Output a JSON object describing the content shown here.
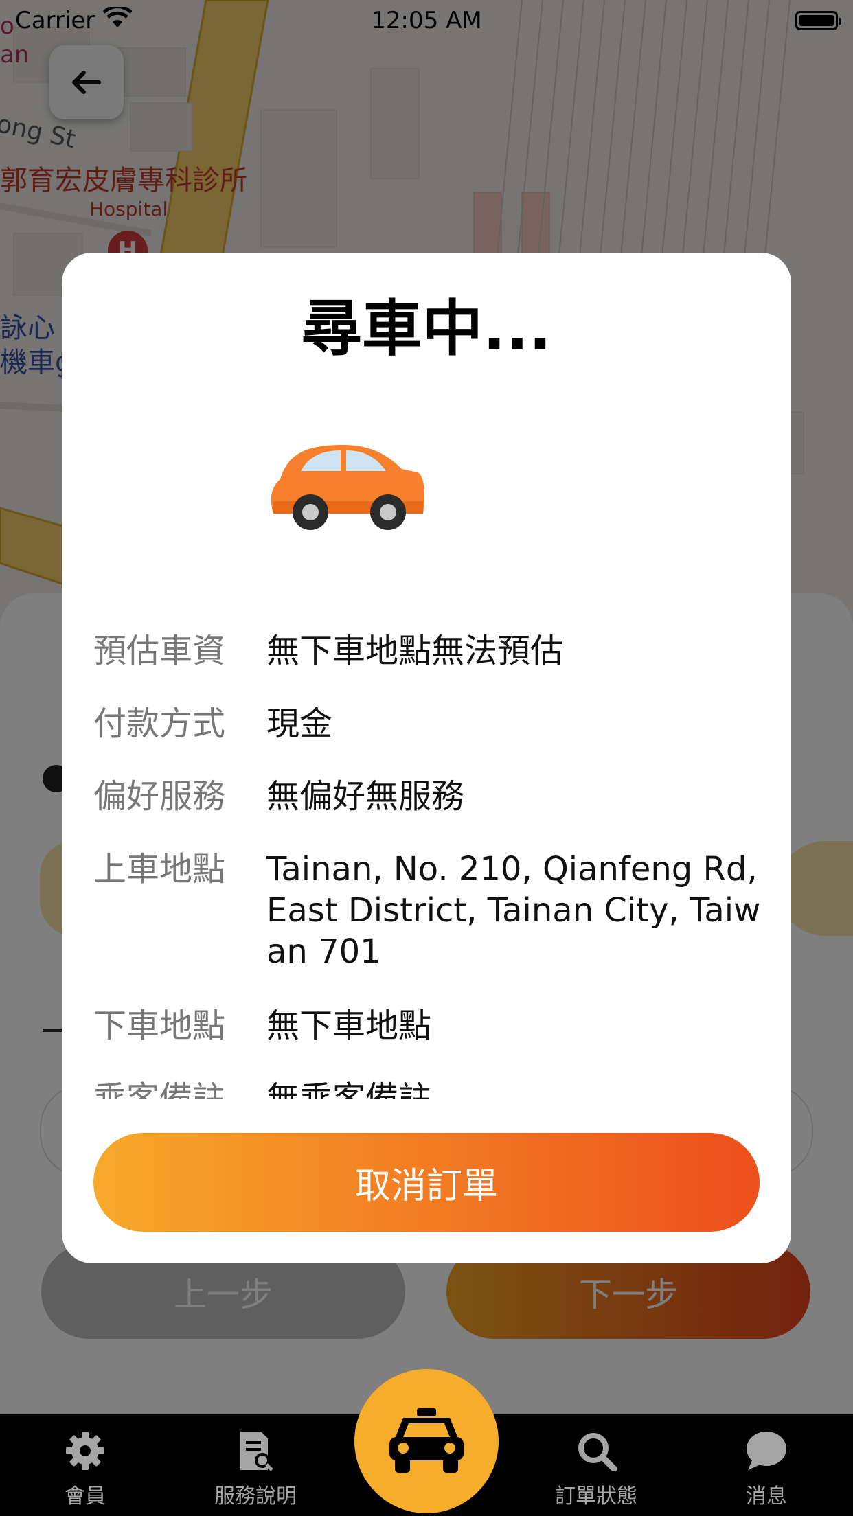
{
  "status_bar": {
    "carrier": "Carrier",
    "time": "12:05 AM"
  },
  "map": {
    "clinic_name": "郭育宏皮膚專科診所",
    "hospital_label": "Hospital",
    "hospital_pin": "H",
    "street_label": "ong St",
    "top_label_1": "o",
    "top_label_2": "an",
    "poi_label_1": "詠心",
    "poi_label_2": "機車g"
  },
  "modal": {
    "title": "尋車中...",
    "rows": [
      {
        "label": "預估車資",
        "value": "無下車地點無法預估"
      },
      {
        "label": "付款方式",
        "value": "現金"
      },
      {
        "label": "偏好服務",
        "value": "無偏好無服務"
      },
      {
        "label": "上車地點",
        "value": "Tainan, No. 210, Qianfeng Rd, East District, Tainan City, Taiwan 701"
      },
      {
        "label": "下車地點",
        "value": "無下車地點"
      },
      {
        "label": "乘客備註",
        "value": "無乘客備註"
      }
    ],
    "cancel_label": "取消訂單"
  },
  "sheet": {
    "prev_label": "上一步",
    "next_label": "下一步"
  },
  "tabs": [
    {
      "label": "會員",
      "icon": "gear-icon"
    },
    {
      "label": "服務說明",
      "icon": "document-search-icon"
    },
    {
      "label": "",
      "icon": "taxi-icon"
    },
    {
      "label": "訂單狀態",
      "icon": "search-icon"
    },
    {
      "label": "消息",
      "icon": "chat-bubble-icon"
    }
  ],
  "colors": {
    "accent_start": "#f7a92a",
    "accent_end": "#ec4f1c",
    "tab_center": "#f6ad2b"
  }
}
